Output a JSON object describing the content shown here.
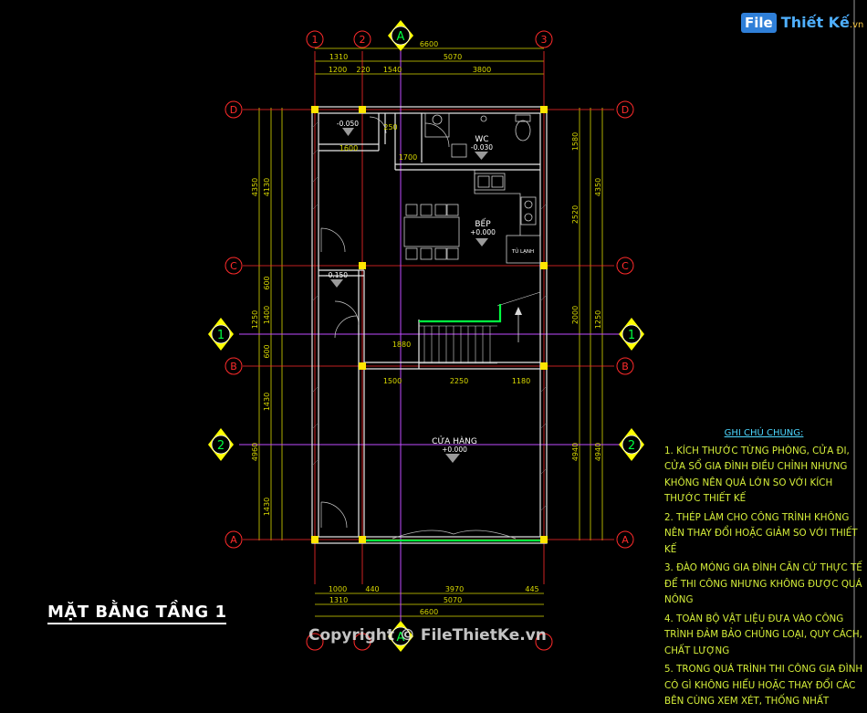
{
  "drawing_title": "MẶT BẰNG TẦNG 1",
  "logo": {
    "badge": "File",
    "name": "Thiết Kế",
    "domain": ".vn"
  },
  "copyright": "Copyright © FileThietKe.vn",
  "colors": {
    "background": "#000000",
    "grid": "#ff2b2b",
    "wall": "#e8e8e8",
    "column": "#ffe600",
    "dim": "#d9d900",
    "accent": "#00ff40",
    "axis": "#c04cff",
    "section": "#ffff00"
  },
  "grid_labels": {
    "top": [
      "1",
      "2",
      "3"
    ],
    "left": [
      "D",
      "C",
      "B",
      "A"
    ],
    "right": [
      "D",
      "C",
      "B",
      "A"
    ],
    "section_top": "A",
    "section_bottom": "A",
    "section_side": [
      "1",
      "2"
    ]
  },
  "dims": {
    "top_total": "6600",
    "top_row1": [
      "1310",
      "5070"
    ],
    "top_row2": [
      "1200",
      "220",
      "1540",
      "3800"
    ],
    "bottom_row1": [
      "1000",
      "440",
      "3970",
      "445"
    ],
    "bottom_row2": [
      "1310",
      "5070"
    ],
    "bottom_total": "6600",
    "left_outer": [
      "4350",
      "1250",
      "4960"
    ],
    "left_inner": [
      "4130",
      "600",
      "1400",
      "600",
      "1430",
      "1430"
    ],
    "right_outer": [
      "4350",
      "1250",
      "4940"
    ],
    "right_inner": [
      "1580",
      "2520",
      "2000",
      "4940"
    ],
    "interior": [
      "1600",
      "1700",
      "250",
      "1500",
      "2250",
      "1180",
      "1880"
    ]
  },
  "rooms": [
    {
      "label": "WC",
      "level": "-0.030"
    },
    {
      "label": "BẾP",
      "level": "+0.000"
    },
    {
      "label": "CỬA HÀNG",
      "level": "+0.000"
    }
  ],
  "levels": [
    "-0.050",
    "-0.150"
  ],
  "fridge_label": "TỦ LẠNH",
  "notes": {
    "heading": "GHI CHÚ CHUNG:",
    "items": [
      "1. KÍCH THƯỚC TỪNG PHÒNG, CỬA ĐI, CỬA SỔ GIA ĐÌNH ĐIỀU CHỈNH NHƯNG KHÔNG NÊN QUÁ LỚN SO VỚI KÍCH THƯỚC THIẾT KẾ",
      "2. THÉP LÀM CHO CÔNG TRÌNH KHÔNG NÊN THAY ĐỔI HOẶC GIẢM SO VỚI THIẾT KẾ",
      "3. ĐÀO MÓNG GIA ĐÌNH CĂN CỨ THỰC TẾ ĐỂ THI CÔNG NHƯNG KHÔNG ĐƯỢC QUÁ NÔNG",
      "4. TOÀN BỘ VẬT LIỆU ĐƯA VÀO CÔNG TRÌNH ĐẢM BẢO CHỦNG LOẠI, QUY CÁCH, CHẤT LƯỢNG",
      "5. TRONG QUÁ TRÌNH THI CÔNG GIA ĐÌNH CÓ GÌ KHÔNG HIỂU HOẶC THAY ĐỔI CÁC BÊN CÙNG XEM XÉT, THỐNG NHẤT"
    ]
  }
}
